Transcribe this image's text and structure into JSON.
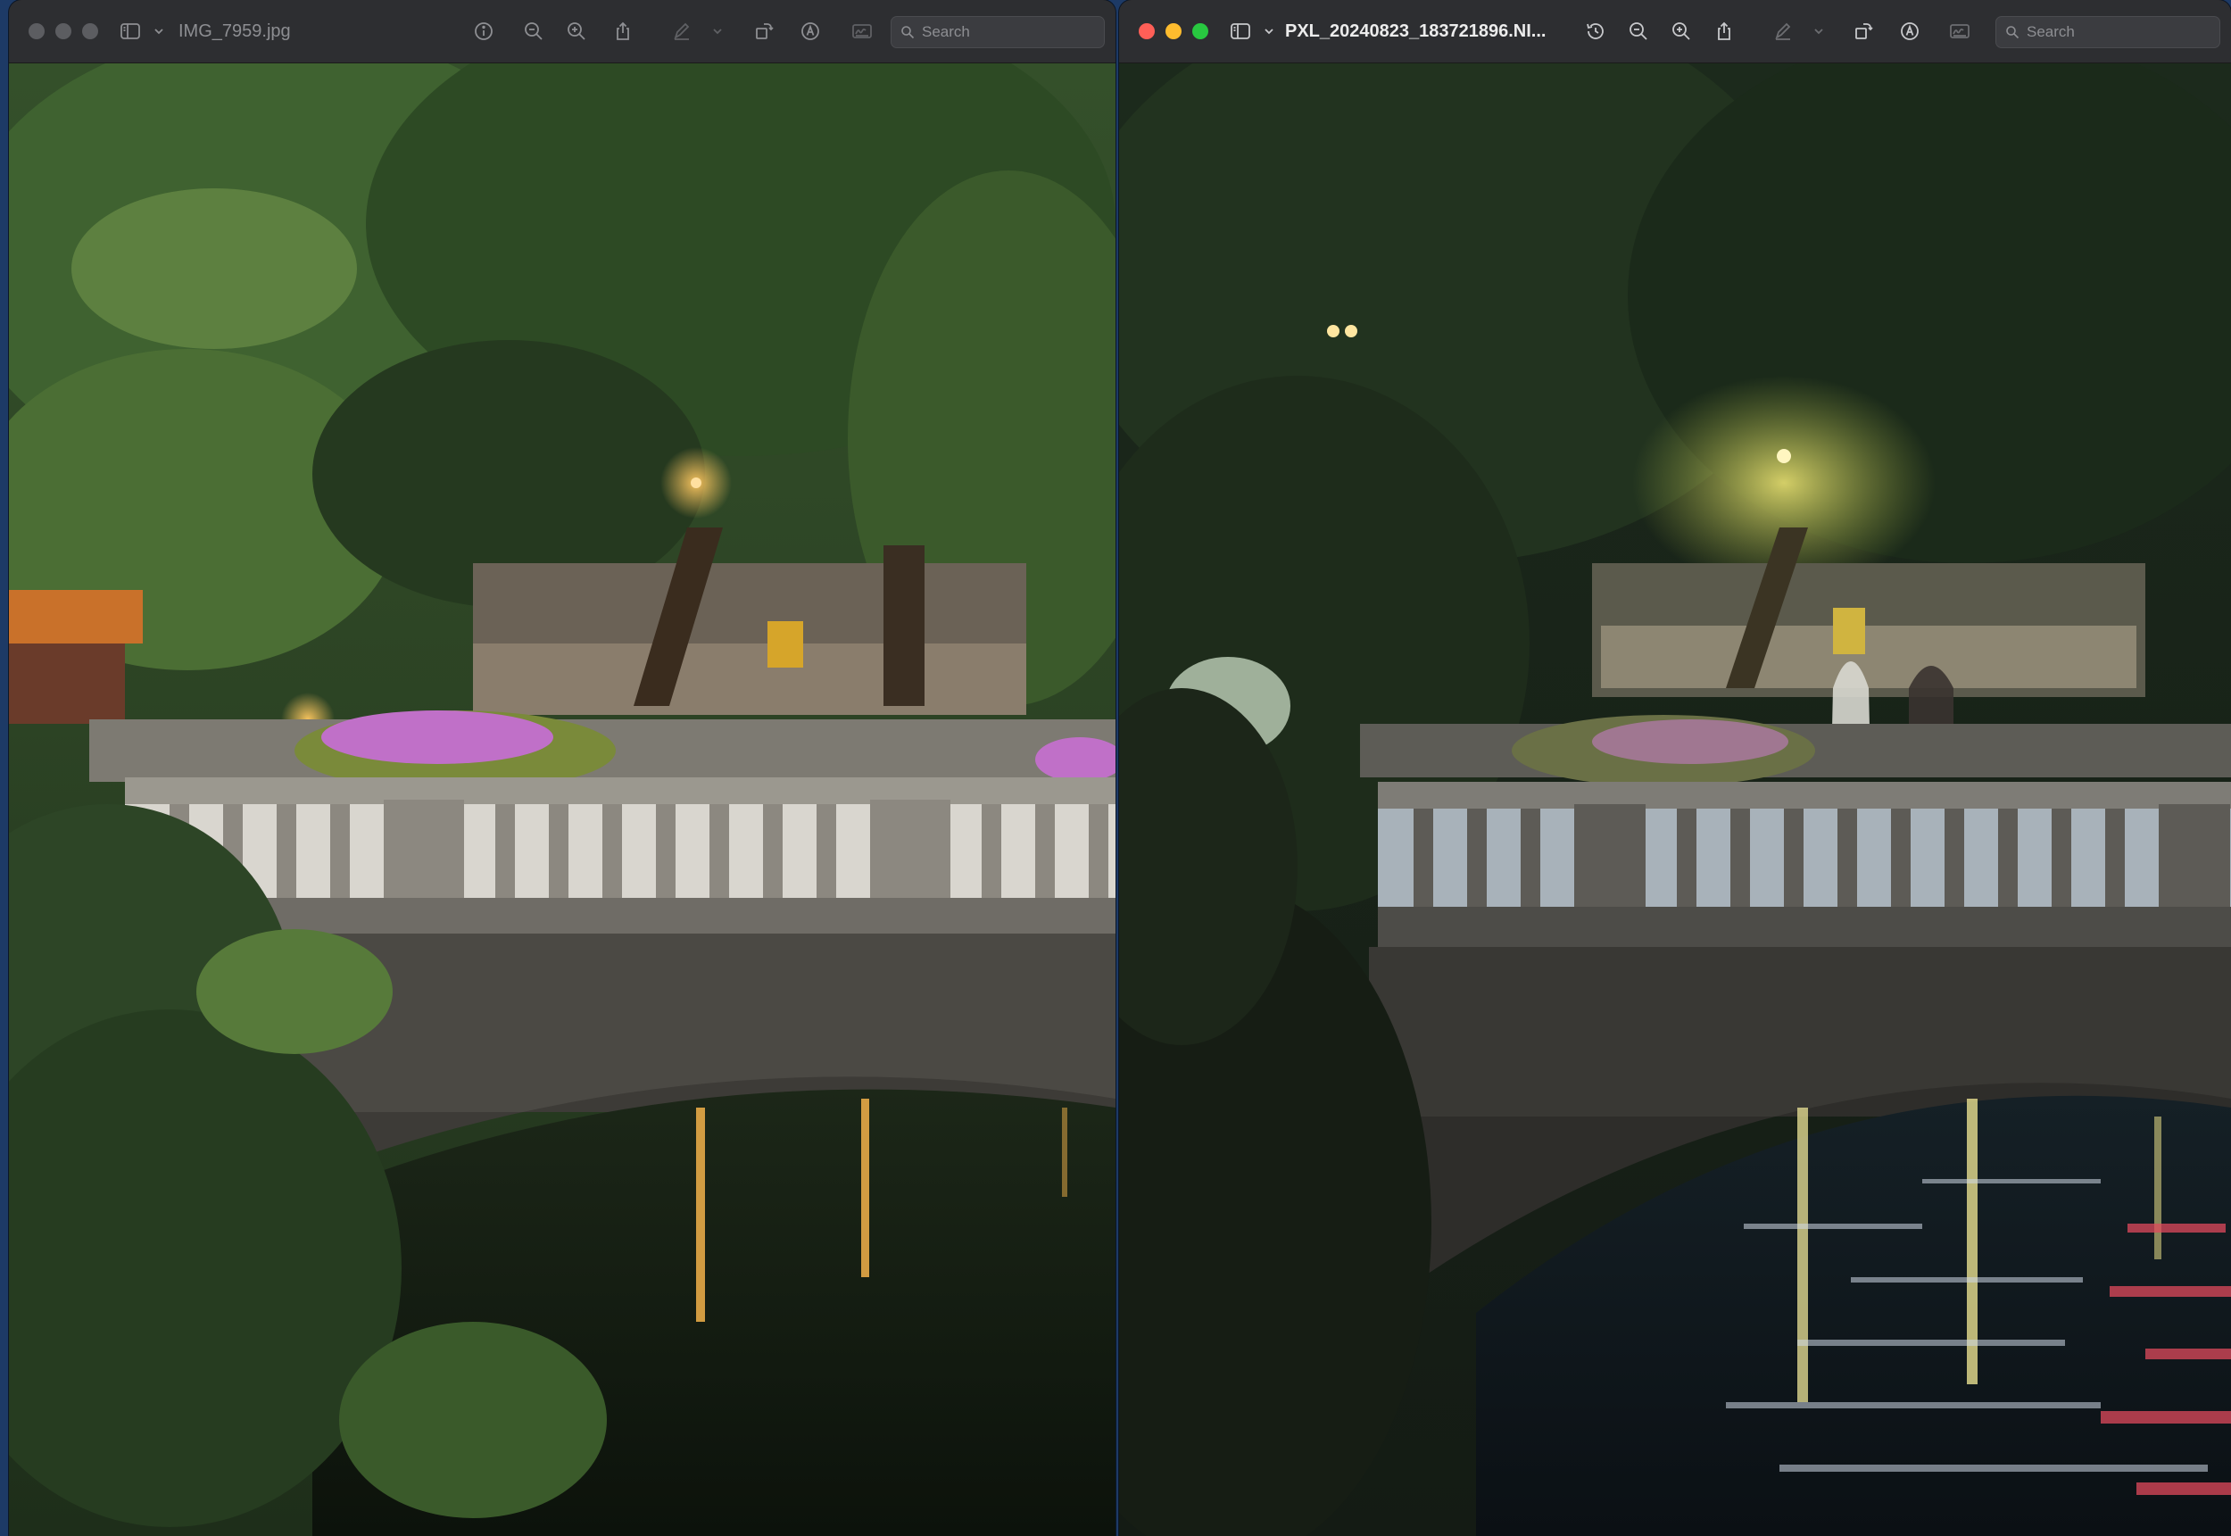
{
  "desktop": {
    "background": "#1d3a66"
  },
  "windows": [
    {
      "id": "left",
      "title": "IMG_7959.jpg",
      "active": false,
      "traffic_lights": [
        "#5c5d61",
        "#5c5d61",
        "#5c5d61"
      ],
      "toolbar_icons": [
        "sidebar-icon",
        "chevron-down-icon",
        "info-icon",
        "zoom-out-icon",
        "zoom-in-icon",
        "share-icon",
        "markup-pen-icon",
        "chevron-down-icon",
        "rotate-icon",
        "annotate-icon",
        "signature-icon"
      ],
      "search": {
        "placeholder": "Search",
        "value": ""
      },
      "photo": {
        "subject": "Stone bridge with balustrade over a canal at dusk, chestnut trees, flower boxes, warm street lights reflecting in dark water",
        "palette": {
          "sky_foliage": "#3e5a30",
          "stone": "#8a8880",
          "water": "#141c12",
          "light": "#f2b24a",
          "flowers": "#c86ac8"
        }
      }
    },
    {
      "id": "right",
      "title": "PXL_20240823_183721896.NI...",
      "active": true,
      "traffic_lights": [
        "#ff5f57",
        "#febc2e",
        "#28c840"
      ],
      "toolbar_icons": [
        "sidebar-icon",
        "chevron-down-icon",
        "history-icon",
        "zoom-out-icon",
        "zoom-in-icon",
        "share-icon",
        "markup-pen-icon",
        "chevron-down-icon",
        "rotate-icon",
        "annotate-icon",
        "signature-icon"
      ],
      "search": {
        "placeholder": "Search",
        "value": ""
      },
      "photo": {
        "subject": "Same stone bridge at night from a phone camera, darker with heavy processing, pedestrians crossing, rippled reflections of street lights and red light",
        "palette": {
          "sky_foliage": "#1f2e1e",
          "stone": "#5a5a56",
          "water": "#0e1418",
          "light": "#e8d880",
          "reflection_red": "#d84a5a"
        }
      }
    }
  ]
}
